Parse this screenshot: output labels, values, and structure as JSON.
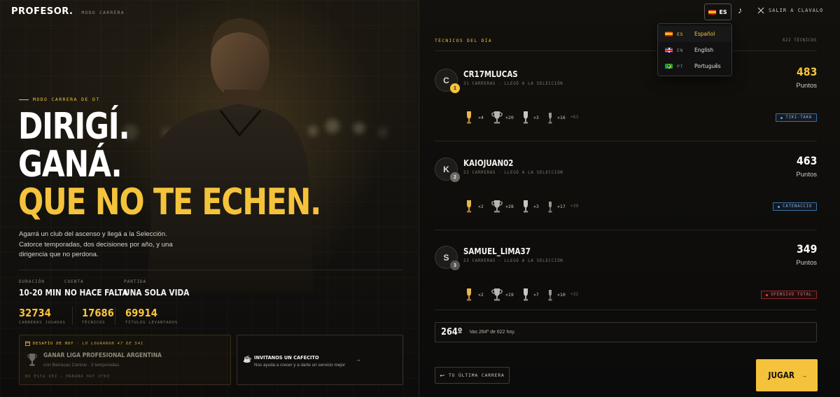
{
  "brand": {
    "logo": "PROFESOR.",
    "subtitle": "MODO CARRERA"
  },
  "topbar": {
    "lang_code": "ES",
    "exit_label": "SALIR A CLAVALO"
  },
  "language_menu": {
    "items": [
      {
        "code": "ES",
        "name": "Español",
        "active": true
      },
      {
        "code": "EN",
        "name": "English",
        "active": false
      },
      {
        "code": "PT",
        "name": "Português",
        "active": false
      }
    ]
  },
  "hero": {
    "eyebrow": "MODO CARRERA DE DT",
    "headline": [
      "DIRIGÍ.",
      "GANÁ.",
      "QUE NO TE ECHEN."
    ],
    "intro": "Agarrá un club del ascenso y llegá a la Selección. Catorce temporadas, dos decisiones por año, y una dirigencia que no perdona."
  },
  "facts": [
    {
      "label": "DURACIÓN",
      "value": "10-20 MIN"
    },
    {
      "label": "CUENTA",
      "value": "NO HACE FALTA"
    },
    {
      "label": "PARTIDA",
      "value": "UNA SOLA VIDA"
    }
  ],
  "totals": [
    {
      "value": "32734",
      "label": "CARRERAS JUGADAS"
    },
    {
      "value": "17686",
      "label": "TÉCNICOS"
    },
    {
      "value": "69914",
      "label": "TÍTULOS LEVANTADOS"
    }
  ],
  "challenge": {
    "header_label": "DESAFÍO DE HOY",
    "header_dash": "·",
    "header_stat": "LO LOGRARON 47 DE 541",
    "title": "GANAR LIGA PROFESIONAL ARGENTINA",
    "subtitle": "con Barracas Central · 3 temporadas",
    "footer": "NO ESTA VEZ — MAÑANA HAY OTRO"
  },
  "coffee": {
    "title": "INVITANOS UN CAFECITO",
    "subtitle": "Nos ayuda a crecer y a darte un servicio mejor",
    "arrow": "→"
  },
  "leaderboard": {
    "title": "TÉCNICOS DEL DÍA",
    "count": "622 TÉCNICOS",
    "players": [
      {
        "initial": "C",
        "rank": "1",
        "name": "CR17MLUCAS",
        "meta": "31 CARRERAS · LLEGÓ A LA SELECCIÓN",
        "points": "483",
        "points_label": "Puntos",
        "trophies": {
          "gold": "×4",
          "cup": "×20",
          "silver": "×3",
          "small": "×16",
          "more": "+63"
        },
        "style": "TIKI-TAKA",
        "style_color": "blue"
      },
      {
        "initial": "K",
        "rank": "2",
        "name": "KAIOJUAN02",
        "meta": "22 CARRERAS · LLEGÓ A LA SELECCIÓN",
        "points": "463",
        "points_label": "Puntos",
        "trophies": {
          "gold": "×2",
          "cup": "×28",
          "silver": "×3",
          "small": "×17",
          "more": "+39"
        },
        "style": "CATENACCIO",
        "style_color": "blue"
      },
      {
        "initial": "S",
        "rank": "3",
        "name": "SAMUEL_LIMA37",
        "meta": "23 CARRERAS · LLEGÓ A LA SELECCIÓN",
        "points": "349",
        "points_label": "Puntos",
        "trophies": {
          "gold": "×2",
          "cup": "×19",
          "silver": "×7",
          "small": "×10",
          "more": "+32"
        },
        "style": "OFENSIVO TOTAL",
        "style_color": "red"
      }
    ],
    "my_position": {
      "number": "264º",
      "text": "Vas 264º de 622 hoy."
    }
  },
  "actions": {
    "last_career": "TU ÚLTIMA CARRERA",
    "play": "JUGAR",
    "play_arrow": "→"
  },
  "colors": {
    "accent": "#f5c33b",
    "background": "#0b0b0b"
  }
}
